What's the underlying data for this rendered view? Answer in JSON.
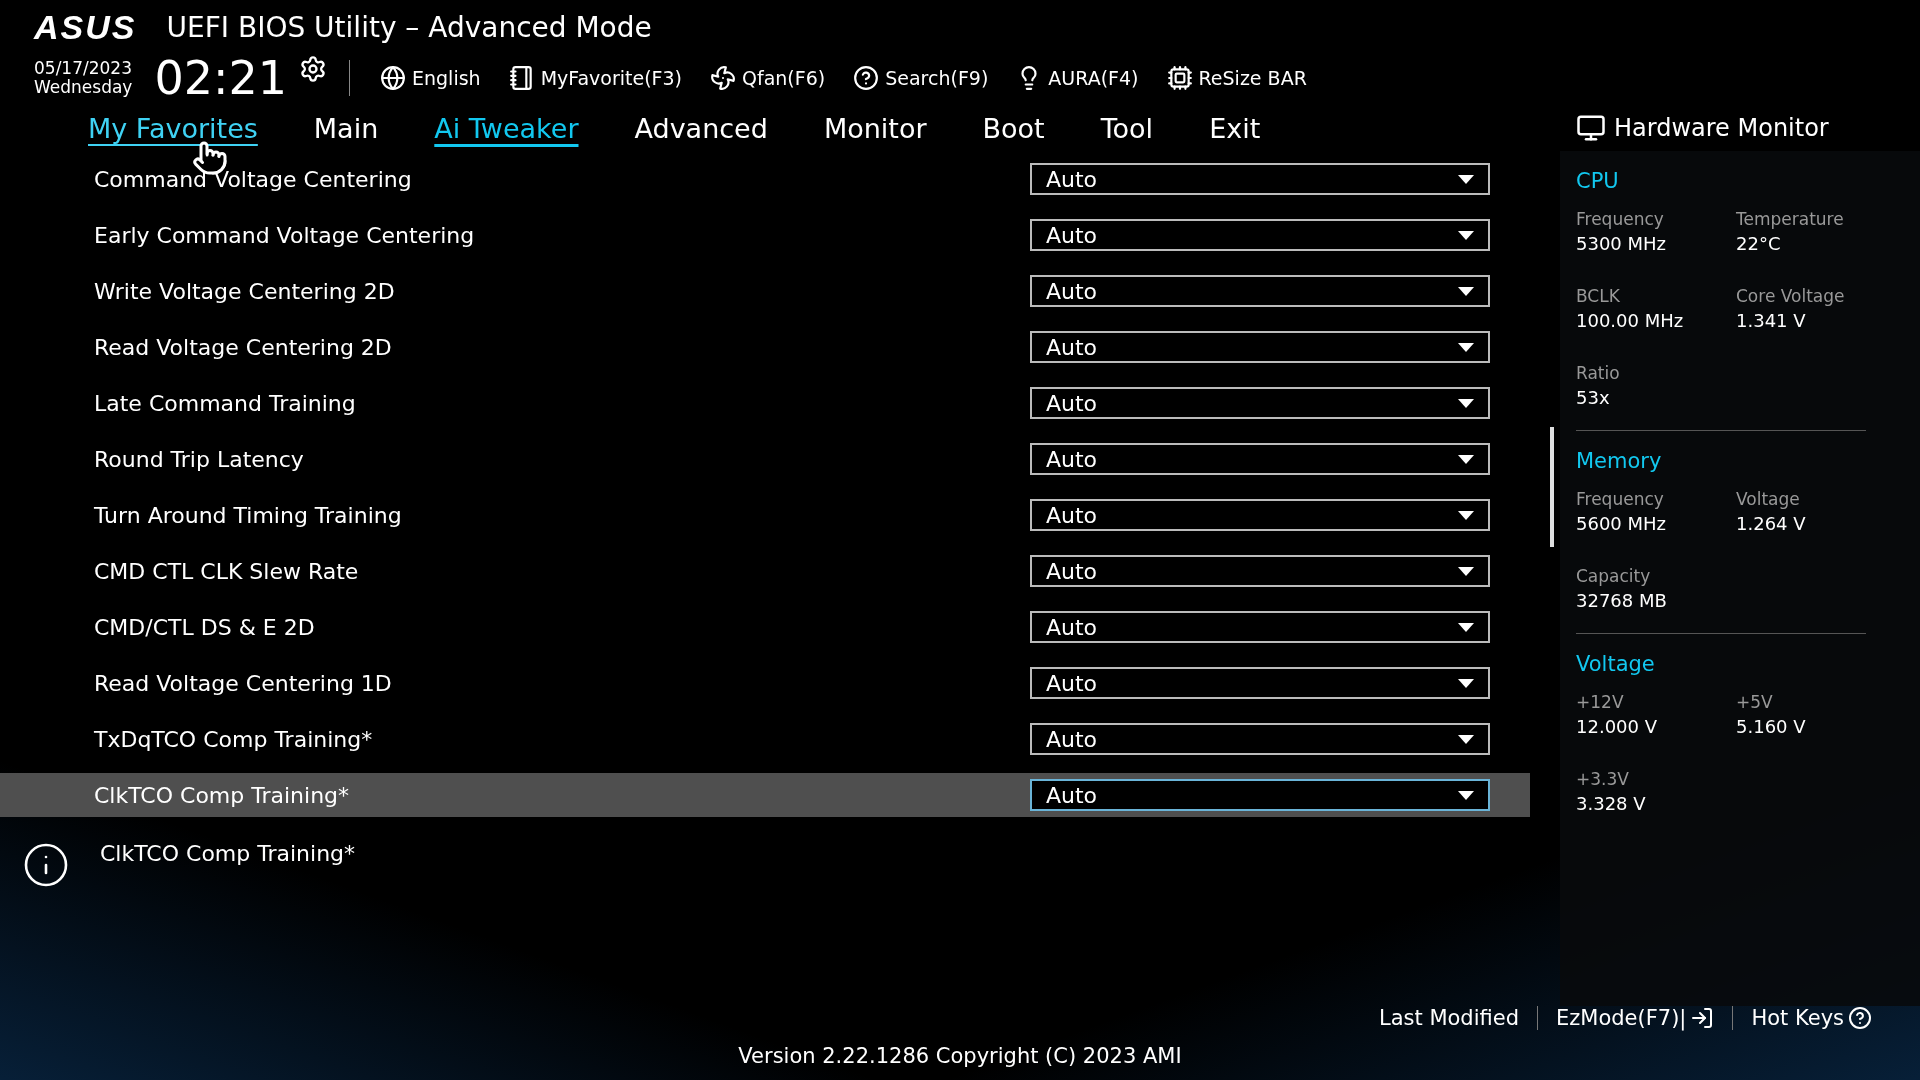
{
  "header": {
    "logo": "ASUS",
    "title": "UEFI BIOS Utility – Advanced Mode",
    "date": "05/17/2023",
    "weekday": "Wednesday",
    "time": "02:21",
    "tools": [
      {
        "kind": "language",
        "label": "English"
      },
      {
        "kind": "favorite",
        "label": "MyFavorite(F3)"
      },
      {
        "kind": "fan",
        "label": "Qfan(F6)"
      },
      {
        "kind": "search",
        "label": "Search(F9)"
      },
      {
        "kind": "aura",
        "label": "AURA(F4)"
      },
      {
        "kind": "resize",
        "label": "ReSize BAR"
      }
    ]
  },
  "tabs": [
    {
      "label": "My Favorites",
      "selected": false,
      "hovered": true
    },
    {
      "label": "Main",
      "selected": false,
      "hovered": false
    },
    {
      "label": "Ai Tweaker",
      "selected": true,
      "hovered": false
    },
    {
      "label": "Advanced",
      "selected": false,
      "hovered": false
    },
    {
      "label": "Monitor",
      "selected": false,
      "hovered": false
    },
    {
      "label": "Boot",
      "selected": false,
      "hovered": false
    },
    {
      "label": "Tool",
      "selected": false,
      "hovered": false
    },
    {
      "label": "Exit",
      "selected": false,
      "hovered": false
    }
  ],
  "settings": [
    {
      "label": "Command Voltage Centering",
      "value": "Auto",
      "selected": false
    },
    {
      "label": "Early Command Voltage Centering",
      "value": "Auto",
      "selected": false
    },
    {
      "label": "Write Voltage Centering 2D",
      "value": "Auto",
      "selected": false
    },
    {
      "label": "Read Voltage Centering 2D",
      "value": "Auto",
      "selected": false
    },
    {
      "label": "Late Command Training",
      "value": "Auto",
      "selected": false
    },
    {
      "label": "Round Trip Latency",
      "value": "Auto",
      "selected": false
    },
    {
      "label": "Turn Around Timing Training",
      "value": "Auto",
      "selected": false
    },
    {
      "label": "CMD CTL CLK Slew Rate",
      "value": "Auto",
      "selected": false
    },
    {
      "label": "CMD/CTL DS & E 2D",
      "value": "Auto",
      "selected": false
    },
    {
      "label": "Read Voltage Centering 1D",
      "value": "Auto",
      "selected": false
    },
    {
      "label": "TxDqTCO Comp Training*",
      "value": "Auto",
      "selected": false
    },
    {
      "label": "ClkTCO Comp Training*",
      "value": "Auto",
      "selected": true
    }
  ],
  "help": {
    "text": "ClkTCO Comp Training*"
  },
  "hardware_monitor": {
    "title": "Hardware Monitor",
    "sections": [
      {
        "title": "CPU",
        "items": [
          {
            "label": "Frequency",
            "value": "5300 MHz"
          },
          {
            "label": "Temperature",
            "value": "22°C"
          },
          {
            "label": "BCLK",
            "value": "100.00 MHz"
          },
          {
            "label": "Core Voltage",
            "value": "1.341 V"
          },
          {
            "label": "Ratio",
            "value": "53x"
          }
        ]
      },
      {
        "title": "Memory",
        "items": [
          {
            "label": "Frequency",
            "value": "5600 MHz"
          },
          {
            "label": "Voltage",
            "value": "1.264 V"
          },
          {
            "label": "Capacity",
            "value": "32768 MB"
          }
        ]
      },
      {
        "title": "Voltage",
        "items": [
          {
            "label": "+12V",
            "value": "12.000 V"
          },
          {
            "label": "+5V",
            "value": "5.160 V"
          },
          {
            "label": "+3.3V",
            "value": "3.328 V"
          }
        ]
      }
    ]
  },
  "footer": {
    "buttons": [
      {
        "kind": "plain",
        "label": "Last Modified"
      },
      {
        "kind": "ezmode",
        "label": "EzMode(F7)|"
      },
      {
        "kind": "hotkeys",
        "label": "Hot Keys"
      }
    ],
    "version": "Version 2.22.1286 Copyright (C) 2023 AMI"
  }
}
